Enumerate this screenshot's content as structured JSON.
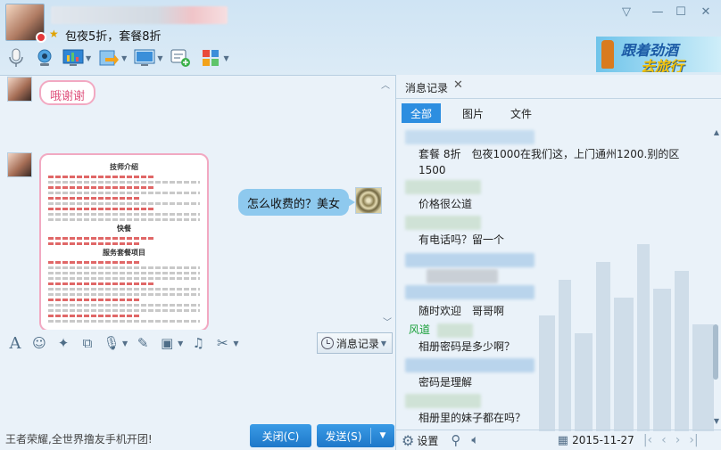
{
  "header": {
    "signature": "包夜5折，套餐8折",
    "ad_line1": "跟着劲酒",
    "ad_line2": "去旅行"
  },
  "chat": {
    "incoming_greeting": "哦谢谢",
    "outgoing_message": "怎么收费的？美女",
    "menu_image": {
      "title": "技师介绍",
      "section1": "快餐",
      "section2": "服务套餐项目"
    }
  },
  "input_tools": {
    "history_label": "消息记录"
  },
  "bottom": {
    "promo_text": "王者荣耀,全世界撸友手机开团!",
    "close_label": "关闭(C)",
    "send_label": "发送(S)"
  },
  "history_panel": {
    "title": "消息记录",
    "filters": [
      "全部",
      "图片",
      "文件"
    ],
    "messages": [
      "套餐 8折　包夜1000在我们这，上门通州1200.别的区1500",
      "价格很公道",
      "有电话吗？留一个",
      "随时欢迎　哥哥啊",
      "相册密码是多少啊？",
      "密码是理解",
      "相册里的妹子都在吗？"
    ],
    "sender_name": "风道",
    "settings_label": "设置",
    "date": "2015-11-27"
  },
  "icons": {
    "mic": "microphone-icon",
    "camera": "camera-icon",
    "screen": "screen-share-icon",
    "file": "file-transfer-icon",
    "remote": "remote-desktop-icon",
    "app": "app-grid-icon"
  },
  "colors": {
    "accent": "#1e78c9",
    "pink": "#f2a9c2",
    "bubble": "#8ec9ee",
    "green_name": "#1aa03a"
  }
}
